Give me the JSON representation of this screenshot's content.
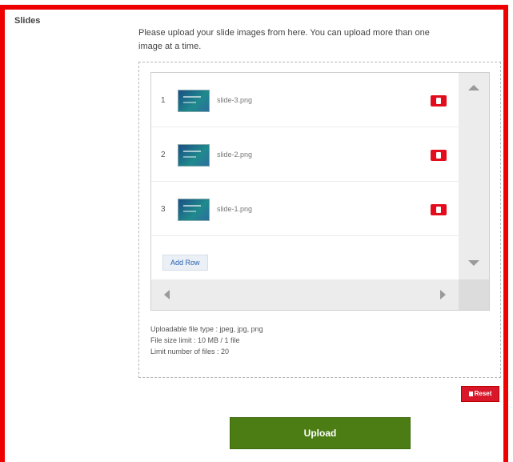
{
  "section": {
    "label": "Slides"
  },
  "intro": {
    "line1": "Please upload your slide images from here. You can upload more than one",
    "line2": "image at a time."
  },
  "files": [
    {
      "num": "1",
      "name": "slide-3.png"
    },
    {
      "num": "2",
      "name": "slide-2.png"
    },
    {
      "num": "3",
      "name": "slide-1.png"
    }
  ],
  "list": {
    "add_row_label": "Add Row"
  },
  "notes": {
    "types": "Uploadable file type : jpeg, jpg, png",
    "size": "File size limit : 10 MB / 1 file",
    "limit": "Limit number of files : 20"
  },
  "actions": {
    "reset_label": "Reset",
    "upload_label": "Upload"
  },
  "colors": {
    "frame": "#ee0000",
    "upload": "#4c7d14",
    "danger": "#e30c1c"
  }
}
